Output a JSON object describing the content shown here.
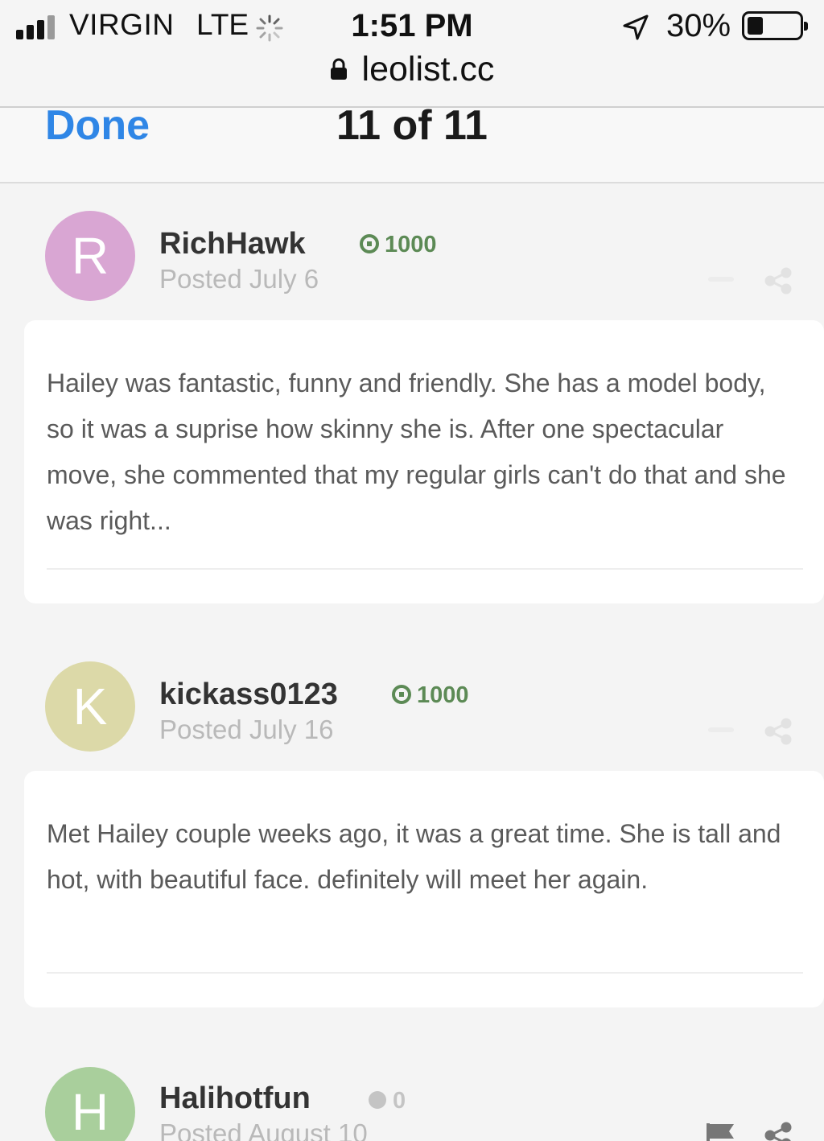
{
  "status_bar": {
    "carrier": "VIRGIN",
    "network": "LTE",
    "time": "1:51 PM",
    "battery_percent": "30%",
    "battery_level": 0.3,
    "url": "leolist.cc",
    "icons": [
      "signal-bars-icon",
      "loading-spinner-icon",
      "location-arrow-icon",
      "battery-icon",
      "lock-icon"
    ]
  },
  "header": {
    "done_label": "Done",
    "page_counter": "11 of 11",
    "accent_color": "#2f86e6"
  },
  "reviews": [
    {
      "avatar_letter": "R",
      "avatar_color": "#d9a6d3",
      "author": "RichHawk",
      "reputation": "1000",
      "posted": "Posted July 6",
      "text": "Hailey was fantastic, funny and friendly. She has a model body, so it was a suprise how skinny she is. After one spectacular move, she commented that my regular girls can't do that and she was right..."
    },
    {
      "avatar_letter": "K",
      "avatar_color": "#dcd9a8",
      "author": "kickass0123",
      "reputation": "1000",
      "posted": "Posted July 16",
      "text": "Met Hailey couple weeks ago, it was a great time. She is tall and hot, with beautiful face. definitely will meet her again."
    },
    {
      "avatar_letter": "H",
      "avatar_color": "#a9cf9c",
      "author": "Halihotfun",
      "reputation": "0",
      "posted": "Posted August 10"
    }
  ]
}
